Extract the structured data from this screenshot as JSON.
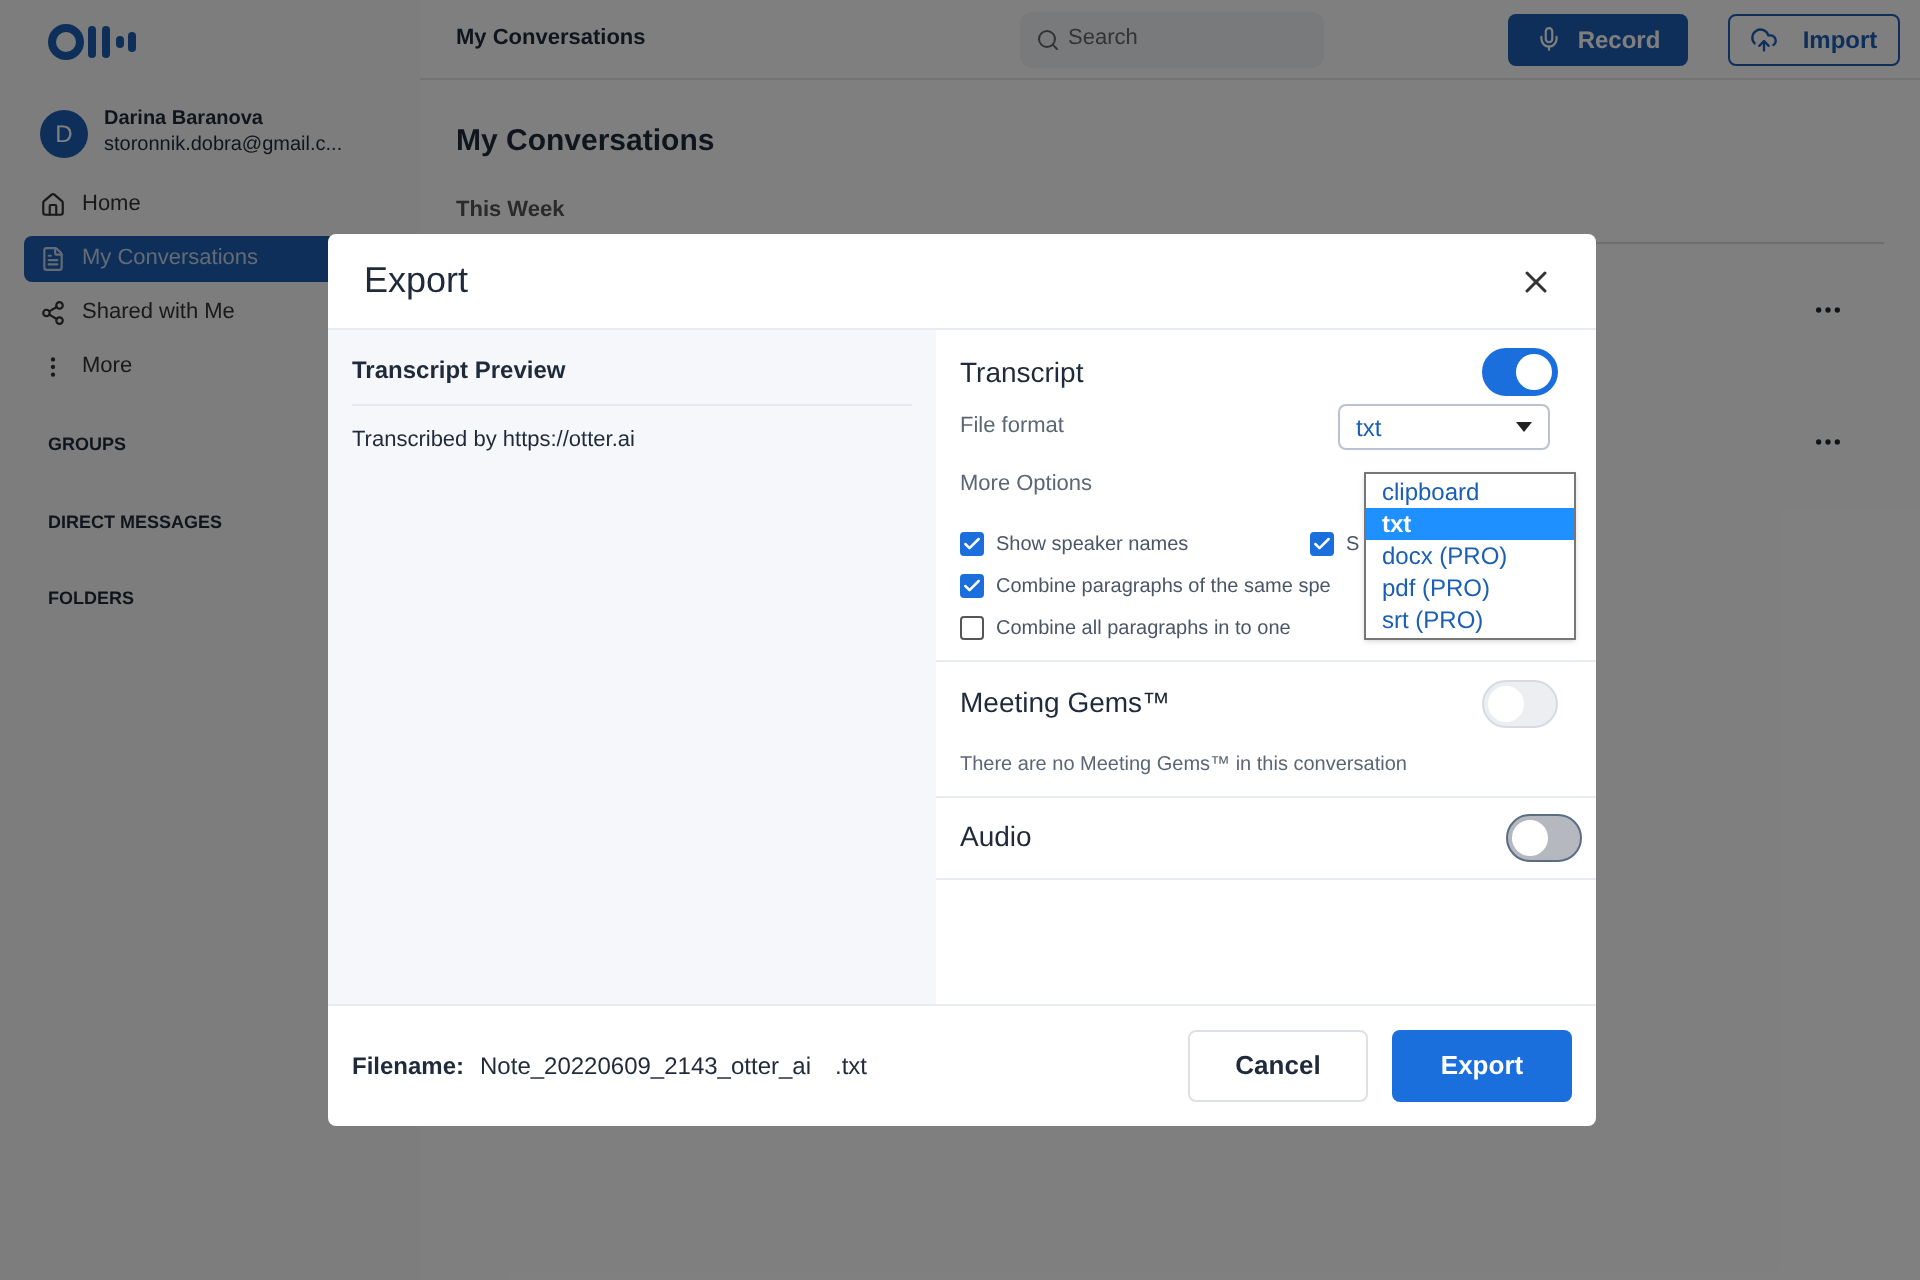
{
  "topbar": {
    "title": "My Conversations",
    "search_placeholder": "Search",
    "record": "Record",
    "import": "Import"
  },
  "user": {
    "initial": "D",
    "name": "Darina Baranova",
    "email": "storonnik.dobra@gmail.c..."
  },
  "nav": [
    {
      "label": "Home",
      "kind": "home",
      "selected": false
    },
    {
      "label": "My Conversations",
      "kind": "conversations",
      "selected": true
    },
    {
      "label": "Shared with Me",
      "kind": "shared",
      "selected": false
    },
    {
      "label": "More",
      "kind": "more",
      "selected": false
    }
  ],
  "sections": [
    "GROUPS",
    "DIRECT MESSAGES",
    "FOLDERS"
  ],
  "main": {
    "title": "My Conversations",
    "subtitle": "This Week"
  },
  "dialog": {
    "title": "Export",
    "preview_title": "Transcript Preview",
    "preview_text": "Transcribed by https://otter.ai",
    "transcript": {
      "label": "Transcript",
      "on": true,
      "file_format_label": "File format",
      "format_value": "txt",
      "more_options": "More Options",
      "options": [
        {
          "label": "Show speaker names",
          "checked": true
        },
        {
          "label": "S",
          "checked": true
        },
        {
          "label": "Combine paragraphs of the same spe",
          "checked": true
        },
        {
          "label": "Combine all paragraphs in to one",
          "checked": false
        }
      ],
      "dropdown": [
        {
          "label": "clipboard",
          "selected": false
        },
        {
          "label": "txt",
          "selected": true
        },
        {
          "label": "docx (PRO)",
          "selected": false
        },
        {
          "label": "pdf (PRO)",
          "selected": false
        },
        {
          "label": "srt (PRO)",
          "selected": false
        }
      ]
    },
    "gems": {
      "label": "Meeting Gems™",
      "on": false,
      "disabled": true,
      "note": "There are no Meeting Gems™ in this conversation"
    },
    "audio": {
      "label": "Audio",
      "on": false,
      "disabled": false
    },
    "filename_label": "Filename:",
    "filename": "Note_20220609_2143_otter_ai",
    "extension": ".txt",
    "cancel": "Cancel",
    "export": "Export"
  }
}
